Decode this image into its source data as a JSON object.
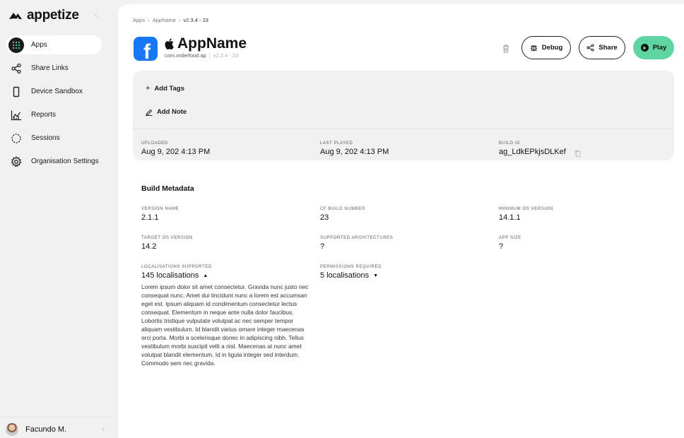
{
  "brand": {
    "name": "appetize"
  },
  "sidebar": {
    "items": [
      {
        "label": "Apps",
        "icon": "grid-icon",
        "active": true
      },
      {
        "label": "Share Links",
        "icon": "share-icon"
      },
      {
        "label": "Device Sandbox",
        "icon": "phone-icon"
      },
      {
        "label": "Reports",
        "icon": "chart-icon"
      },
      {
        "label": "Sessions",
        "icon": "sessions-icon"
      },
      {
        "label": "Organisation Settings",
        "icon": "gear-icon"
      }
    ],
    "user": {
      "name": "Facundo M."
    }
  },
  "breadcrumb": {
    "root": "Apps",
    "app": "AppName",
    "version": "v2.3.4 - 23"
  },
  "app": {
    "name": "AppName",
    "bundle": "com.orderfood.ap",
    "version": "v2.3.4 - 23",
    "platform_icon": "apple-icon",
    "icon_letter": "f"
  },
  "actions": {
    "debug": "Debug",
    "share": "Share",
    "play": "Play"
  },
  "card": {
    "add_tags": "Add Tags",
    "add_note": "Add Note",
    "uploaded_label": "UPLOADED",
    "uploaded_value": "Aug 9, 202 4:13 PM",
    "last_played_label": "LAST PLAYED",
    "last_played_value": "Aug 9, 202 4:13 PM",
    "build_id_label": "BUILD ID",
    "build_id_value": "ag_LdkEPkjsDLKef"
  },
  "metadata": {
    "title": "Build Metadata",
    "version_name_label": "VERSION NAME",
    "version_name_value": "2.1.1",
    "cf_build_label": "CF BUILD NUMBER",
    "cf_build_value": "23",
    "min_os_label": "MINIMUM OS VERSION",
    "min_os_value": "14.1.1",
    "target_os_label": "TARGET OS VERSION",
    "target_os_value": "14.2",
    "arch_label": "SUPPORTED ARCHITECTURES",
    "arch_value": "?",
    "app_size_label": "APP SIZE",
    "app_size_value": "?",
    "localisations_label": "LOCALISATIONS SUPPORTED",
    "localisations_value": "145 localisations",
    "permissions_label": "PERMISSIONS REQUIRED",
    "permissions_value": "5 localisations",
    "localisations_text": "Lorem ipsum dolor sit amet consectetur. Gravida nunc justo nec consequat nunc. Amet dui tincidunt nunc a lorem est accumsan eget est. Ipsum aliquam id condimentum consectetur lectus consequat. Elementum in neque ante nulla dolor faucibus. Lobortis tristique vulputate volutpat ac nec semper tempor aliquam vestibulum. Id blandit varius ornare integer maecenas orci porta. Morbi a scelerisque donec in adipiscing nibh. Tellus vestibulum morbi suscipit velit a nisl. Maecenas at nunc amet volutpat blandit elementum. Id in ligula integer sed interdum. Commodo sem nec gravida."
  },
  "colors": {
    "accent_play": "#5fd6a1",
    "facebook_blue": "#1877f2"
  }
}
